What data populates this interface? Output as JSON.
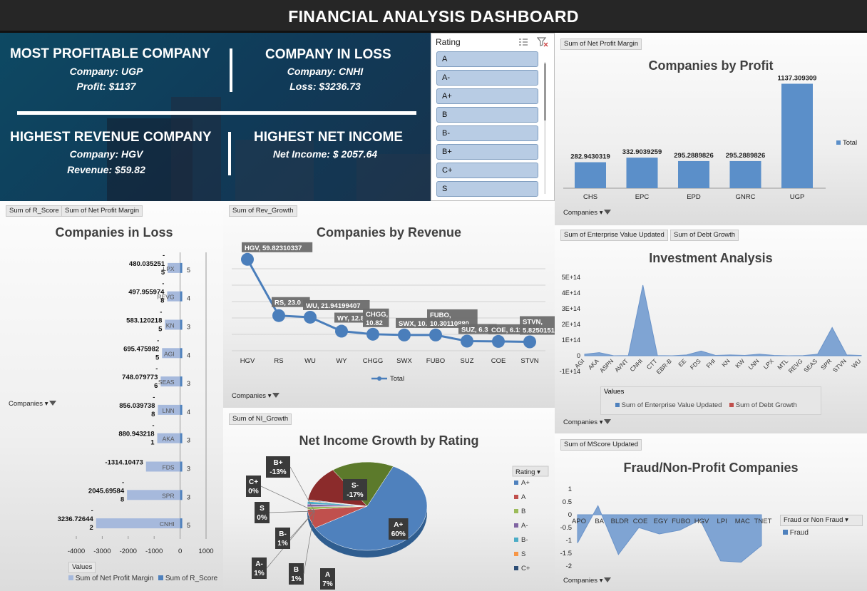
{
  "title": "FINANCIAL ANALYSIS DASHBOARD",
  "kpis": {
    "most_profitable": {
      "heading": "MOST PROFITABLE COMPANY",
      "line1": "Company: UGP",
      "line2": "Profit: $1137"
    },
    "in_loss": {
      "heading": "COMPANY IN LOSS",
      "line1": "Company: CNHI",
      "line2": "Loss: $3236.73"
    },
    "highest_revenue": {
      "heading": "HIGHEST REVENUE COMPANY",
      "line1": "Company: HGV",
      "line2": "Revenue: $59.82"
    },
    "highest_net_income": {
      "heading": "HIGHEST NET INCOME",
      "line1": "Net Income: $ 2057.64"
    }
  },
  "slicer": {
    "title": "Rating",
    "items": [
      "A",
      "A-",
      "A+",
      "B",
      "B-",
      "B+",
      "C+",
      "S"
    ]
  },
  "fields": {
    "profit": "Sum of Net Profit Margin",
    "loss_a": "Sum of R_Score",
    "loss_b": "Sum of Net Profit Margin",
    "revenue": "Sum of Rev_Growth",
    "investment_a": "Sum of Enterprise  Value Updated",
    "investment_b": "Sum of Debt Growth",
    "ni": "Sum of NI_Growth",
    "fraud": "Sum of MScore Updated",
    "companies": "Companies",
    "values": "Values"
  },
  "chart_data": [
    {
      "id": "profit",
      "type": "bar",
      "title": "Companies by Profit",
      "categories": [
        "CHS",
        "EPC",
        "EPD",
        "GNRC",
        "UGP"
      ],
      "values": [
        282.9430319,
        332.9039259,
        295.2889826,
        295.2889826,
        1137.309309
      ],
      "value_labels": [
        "282.9430319",
        "332.9039259",
        "295.2889826",
        "295.2889826",
        "1137.309309"
      ],
      "legend": [
        "Total"
      ],
      "color": "#5b8fc9"
    },
    {
      "id": "loss",
      "type": "bar",
      "orientation": "horizontal",
      "title": "Companies in Loss",
      "categories": [
        "LPX",
        "REVG",
        "KN",
        "AGI",
        "SEAS",
        "LNN",
        "AKA",
        "FDS",
        "SPR",
        "CNHI"
      ],
      "series": [
        {
          "name": "Sum of Net Profit Margin",
          "values": [
            -480.0352515,
            -497.9559748,
            -583.1202185,
            -695.4759825,
            -748.0797736,
            -856.0397388,
            -880.9432181,
            -1314.10473,
            -2045.695848,
            -3236.726442
          ]
        },
        {
          "name": "Sum of R_Score",
          "values": [
            5,
            4,
            3,
            4,
            3,
            4,
            3,
            3,
            3,
            5
          ]
        }
      ],
      "value_labels": [
        [
          "-",
          "480.035251",
          "5"
        ],
        [
          "-",
          "497.955974",
          "8"
        ],
        [
          "-",
          "583.120218",
          "5"
        ],
        [
          "-",
          "695.475982",
          "5"
        ],
        [
          "-",
          "748.079773",
          "6"
        ],
        [
          "-",
          "856.039738",
          "8"
        ],
        [
          "-",
          "880.943218",
          "1"
        ],
        [
          "-1314.10473"
        ],
        [
          "-",
          "2045.69584",
          "8"
        ],
        [
          "-",
          "3236.72644",
          "2"
        ]
      ],
      "r_score_labels": [
        "5",
        "4",
        "3",
        "4",
        "3",
        "4",
        "3",
        "3",
        "3",
        "5"
      ],
      "x_ticks": [
        "-4000",
        "-3000",
        "-2000",
        "-1000",
        "0",
        "1000"
      ],
      "xlim": [
        -4000,
        1000
      ],
      "legend_title": "Values",
      "colors": [
        "#a6b9dc",
        "#4f81bd"
      ]
    },
    {
      "id": "revenue",
      "type": "line",
      "title": "Companies by Revenue",
      "categories": [
        "HGV",
        "RS",
        "WU",
        "WY",
        "CHGG",
        "SWX",
        "FUBO",
        "SUZ",
        "COE",
        "STVN"
      ],
      "values": [
        59.82310337,
        23.0,
        21.94199407,
        12.831,
        10.82,
        10.3,
        10.3011088,
        6.3,
        6.1152,
        5.825015179
      ],
      "data_labels": [
        "HGV, 59.82310337",
        "RS, 23.0",
        "WU, 21.94199407",
        "WY, 12.831",
        "CHGG,",
        "SWX, 10.30",
        "FUBO,",
        "SUZ, 6.3",
        "COE, 6.1152",
        "STVN,"
      ],
      "data_labels_2": [
        "",
        "",
        "",
        "",
        "10.82",
        "",
        "10.30110880",
        "",
        "",
        "5.825015179"
      ],
      "legend": [
        "Total"
      ],
      "ylim": [
        0,
        70
      ],
      "color": "#4a7ebb"
    },
    {
      "id": "investment",
      "type": "area",
      "title": "Investment Analysis",
      "categories": [
        "AGI",
        "AKA",
        "ASPN",
        "AVNT",
        "CNHI",
        "CTT",
        "EBR-B",
        "EE",
        "FDS",
        "FHI",
        "KN",
        "KW",
        "LNN",
        "LPX",
        "MTL",
        "REVG",
        "SEAS",
        "SPR",
        "STVN",
        "WU"
      ],
      "series": [
        {
          "name": "Sum of Enterprise  Value Updated",
          "values": [
            10000000000000.0,
            20000000000000.0,
            0,
            1000000000000.0,
            450000000000000.0,
            1000000000000.0,
            0,
            5000000000000.0,
            30000000000000.0,
            2000000000000.0,
            5000000000000.0,
            2000000000000.0,
            10000000000000.0,
            2000000000000.0,
            0,
            1000000000000.0,
            10000000000000.0,
            180000000000000.0,
            5000000000000.0,
            2000000000000.0
          ]
        },
        {
          "name": "Sum of Debt Growth",
          "values": [
            0,
            0,
            0,
            0,
            0,
            0,
            0,
            0,
            0,
            0,
            0,
            0,
            0,
            0,
            0,
            0,
            0,
            0,
            0,
            0
          ]
        }
      ],
      "y_ticks": [
        "5E+14",
        "4E+14",
        "3E+14",
        "2E+14",
        "1E+14",
        "0",
        "-1E+14"
      ],
      "ylim": [
        -100000000000000.0,
        500000000000000.0
      ],
      "legend_title": "Values",
      "colors": [
        "#4f81bd",
        "#c0504d"
      ]
    },
    {
      "id": "ni_growth",
      "type": "pie",
      "title": "Net Income Growth by Rating",
      "categories": [
        "A+",
        "A",
        "B",
        "A-",
        "B-",
        "S",
        "C+",
        "B+",
        "S-"
      ],
      "values": [
        60,
        7,
        1,
        1,
        1,
        0,
        0,
        -13,
        -17
      ],
      "labels": [
        "A+\n60%",
        "A\n7%",
        "B\n1%",
        "A-\n1%",
        "B-\n1%",
        "S\n0%",
        "C+\n0%",
        "B+\n-13%",
        "S-\n-17%"
      ],
      "legend_title": "Rating",
      "legend": [
        "A+",
        "A",
        "B",
        "A-",
        "B-",
        "S",
        "C+"
      ],
      "colors": [
        "#4f81bd",
        "#c0504d",
        "#9bbb59",
        "#8064a2",
        "#4bacc6",
        "#f79646",
        "#2c4d75"
      ]
    },
    {
      "id": "fraud",
      "type": "area",
      "title": "Fraud/Non-Profit Companies",
      "categories": [
        "APO",
        "BA",
        "BLDR",
        "COE",
        "EGY",
        "FUBO",
        "HGV",
        "LPI",
        "MAC",
        "TNET"
      ],
      "values": [
        -1.1,
        0.35,
        -1.55,
        -0.5,
        -0.75,
        -0.6,
        -0.2,
        -1.8,
        -1.85,
        -1.2
      ],
      "y_ticks": [
        "1",
        "0.5",
        "0",
        "-0.5",
        "-1",
        "-1.5",
        "-2"
      ],
      "ylim": [
        -2,
        1
      ],
      "legend_title": "Fraud or  Non Fraud",
      "legend": [
        "Fraud"
      ],
      "color": "#4f81bd"
    }
  ]
}
